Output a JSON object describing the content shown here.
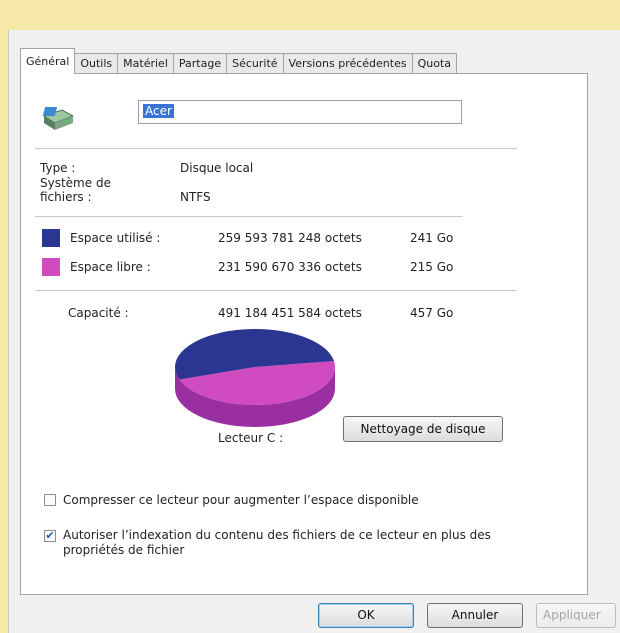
{
  "tabs": [
    "Général",
    "Outils",
    "Matériel",
    "Partage",
    "Sécurité",
    "Versions précédentes",
    "Quota"
  ],
  "drive_icon": "drive-icon",
  "name_field": {
    "value": "Acer"
  },
  "type_label": "Type :",
  "type_value": "Disque local",
  "fs_label_line1": "Système de",
  "fs_label_line2": "fichiers :",
  "fs_value": "NTFS",
  "used": {
    "label": "Espace utilisé :",
    "bytes": "259 593 781 248 octets",
    "size": "241 Go",
    "color": "#2b3592"
  },
  "free": {
    "label": "Espace libre :",
    "bytes": "231 590 670 336 octets",
    "size": "215 Go",
    "color": "#d04bc0"
  },
  "capacity": {
    "label": "Capacité :",
    "bytes": "491 184 451 584 octets",
    "size": "457 Go"
  },
  "chart_data": {
    "type": "pie",
    "values": [
      241,
      215
    ]
  },
  "drive_label": "Lecteur C :",
  "cleanup_button": "Nettoyage de disque",
  "compress": {
    "label": "Compresser ce lecteur pour augmenter l’espace disponible",
    "checked": false
  },
  "index": {
    "line1": "Autoriser l’indexation du contenu des fichiers de ce lecteur en plus des",
    "line2": "propriétés de fichier",
    "checked": true
  },
  "buttons": {
    "ok": "OK",
    "cancel": "Annuler",
    "apply": "Appliquer"
  }
}
